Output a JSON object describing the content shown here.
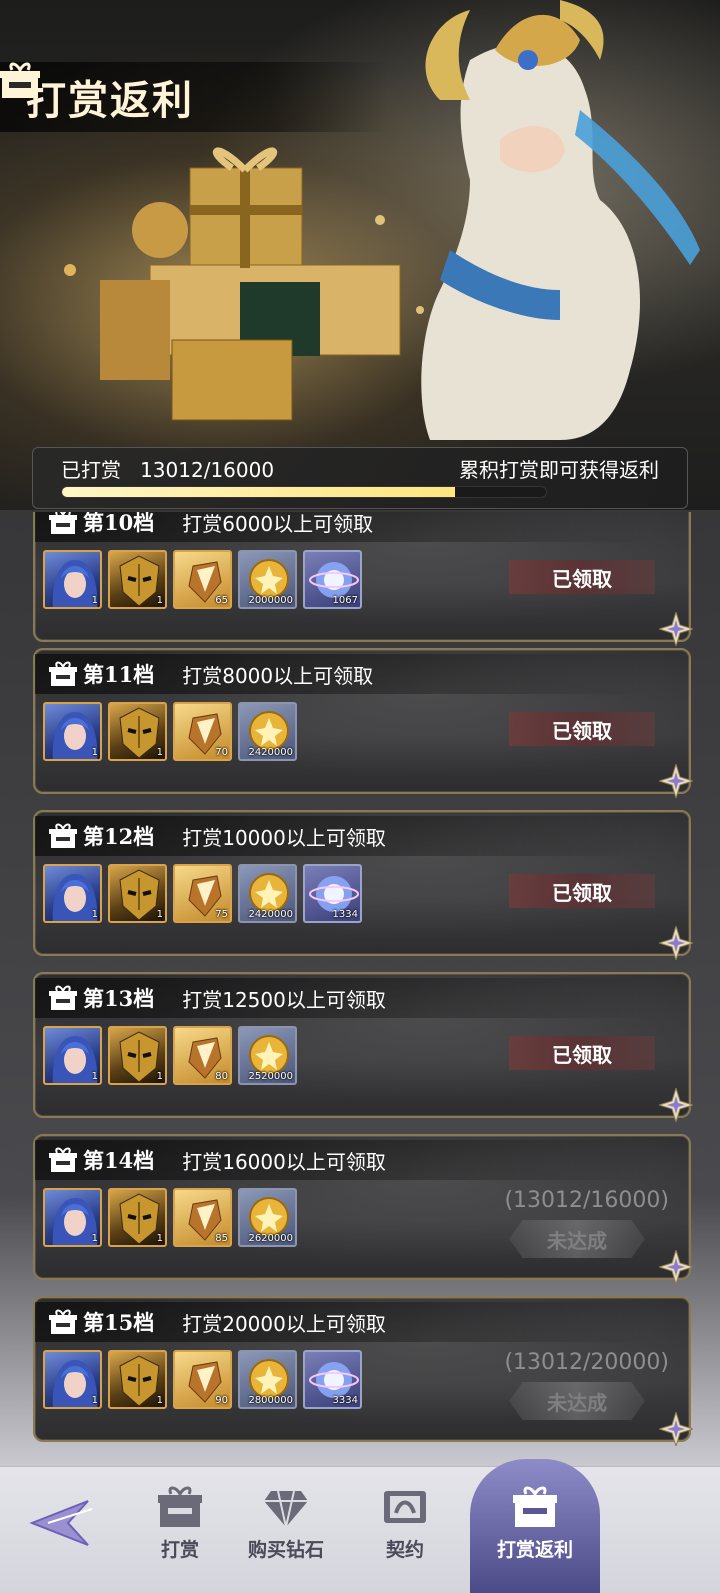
{
  "header": {
    "title": "打赏返利",
    "title_icon": "gift-icon"
  },
  "progress": {
    "label": "已打赏",
    "current": 13012,
    "target": 16000,
    "value_text": "13012/16000",
    "fraction": 0.813,
    "hint": "累积打赏即可获得返利"
  },
  "tiers": [
    {
      "name": "第10档",
      "requirement": "打赏6000以上可领取",
      "items": [
        {
          "kind": "hero",
          "qty": "1"
        },
        {
          "kind": "mask",
          "qty": "1"
        },
        {
          "kind": "shard",
          "qty": "65"
        },
        {
          "kind": "coin",
          "qty": "2000000"
        },
        {
          "kind": "orb",
          "qty": "1067"
        }
      ],
      "status": "claimed",
      "status_label": "已领取"
    },
    {
      "name": "第11档",
      "requirement": "打赏8000以上可领取",
      "items": [
        {
          "kind": "hero",
          "qty": "1"
        },
        {
          "kind": "mask",
          "qty": "1"
        },
        {
          "kind": "shard",
          "qty": "70"
        },
        {
          "kind": "coin",
          "qty": "2420000"
        }
      ],
      "status": "claimed",
      "status_label": "已领取"
    },
    {
      "name": "第12档",
      "requirement": "打赏10000以上可领取",
      "items": [
        {
          "kind": "hero",
          "qty": "1"
        },
        {
          "kind": "mask",
          "qty": "1"
        },
        {
          "kind": "shard",
          "qty": "75"
        },
        {
          "kind": "coin",
          "qty": "2420000"
        },
        {
          "kind": "orb",
          "qty": "1334"
        }
      ],
      "status": "claimed",
      "status_label": "已领取"
    },
    {
      "name": "第13档",
      "requirement": "打赏12500以上可领取",
      "items": [
        {
          "kind": "hero",
          "qty": "1"
        },
        {
          "kind": "mask",
          "qty": "1"
        },
        {
          "kind": "shard",
          "qty": "80"
        },
        {
          "kind": "coin",
          "qty": "2520000"
        }
      ],
      "status": "claimed",
      "status_label": "已领取"
    },
    {
      "name": "第14档",
      "requirement": "打赏16000以上可领取",
      "items": [
        {
          "kind": "hero",
          "qty": "1"
        },
        {
          "kind": "mask",
          "qty": "1"
        },
        {
          "kind": "shard",
          "qty": "85"
        },
        {
          "kind": "coin",
          "qty": "2620000"
        }
      ],
      "status": "pending",
      "status_count": "(13012/16000)",
      "status_label": "未达成"
    },
    {
      "name": "第15档",
      "requirement": "打赏20000以上可领取",
      "items": [
        {
          "kind": "hero",
          "qty": "1"
        },
        {
          "kind": "mask",
          "qty": "1"
        },
        {
          "kind": "shard",
          "qty": "90"
        },
        {
          "kind": "coin",
          "qty": "2800000"
        },
        {
          "kind": "orb",
          "qty": "3334"
        }
      ],
      "status": "pending",
      "status_count": "(13012/20000)",
      "status_label": "未达成"
    }
  ],
  "nav": {
    "back_icon": "back-arrow-icon",
    "items": [
      {
        "label": "打赏",
        "icon": "gift-icon",
        "active": false
      },
      {
        "label": "购买钻石",
        "icon": "diamond-icon",
        "active": false
      },
      {
        "label": "契约",
        "icon": "contract-icon",
        "active": false
      },
      {
        "label": "打赏返利",
        "icon": "gift-icon",
        "active": true
      }
    ]
  },
  "colors": {
    "claimed_bg": "#6e3c3c",
    "progress_fill": "#ffe680",
    "nav_active": "#6a68a8",
    "item_border_gold": "#d8a34a"
  }
}
